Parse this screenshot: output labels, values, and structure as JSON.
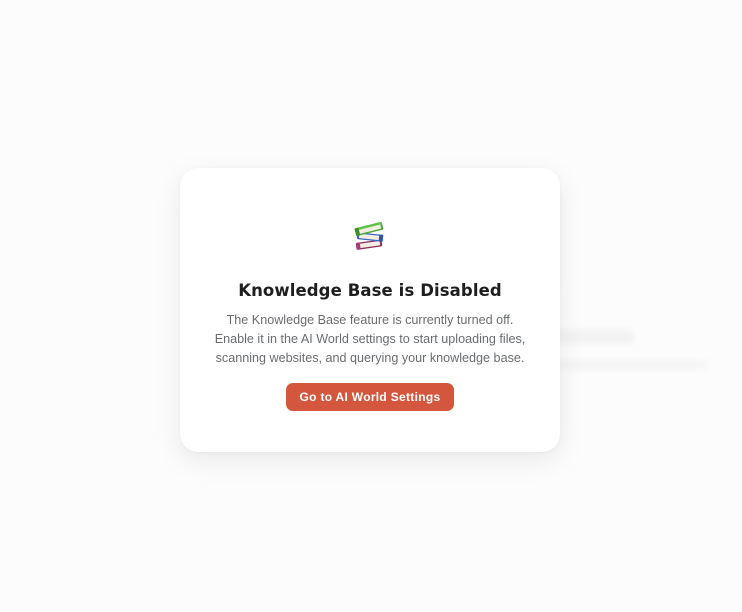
{
  "modal": {
    "icon": "books-icon",
    "title": "Knowledge Base is Disabled",
    "description_lines": [
      "The Knowledge Base feature is currently turned off.",
      "Enable it in the AI World settings to start uploading files,",
      "scanning websites, and querying your knowledge base."
    ],
    "button_label": "Go to AI World Settings"
  },
  "colors": {
    "page_background": "#fcfcfc",
    "modal_background": "#ffffff",
    "title_text": "#1e1e1e",
    "body_text": "#6a6d70",
    "button_background": "#d4563d",
    "button_text": "#ffffff"
  }
}
